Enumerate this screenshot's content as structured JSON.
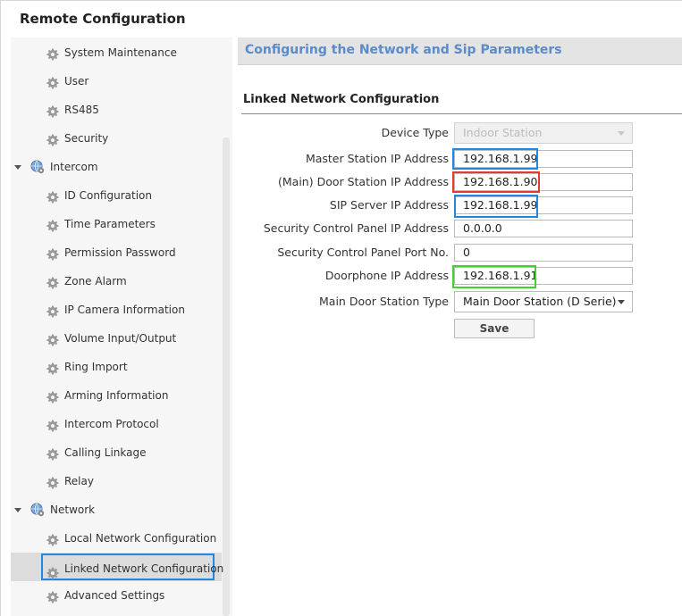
{
  "window": {
    "title": "Remote Configuration"
  },
  "colors": {
    "accent_blue": "#1e88e5",
    "highlight_red": "#e53935",
    "highlight_green": "#43d12f",
    "header_text": "#5b8bc9"
  },
  "sidebar": {
    "items": [
      {
        "label": "System Maintenance",
        "icon": "gear-icon"
      },
      {
        "label": "User",
        "icon": "gear-icon"
      },
      {
        "label": "RS485",
        "icon": "gear-icon"
      },
      {
        "label": "Security",
        "icon": "gear-icon"
      },
      {
        "label": "Intercom",
        "icon": "globe-icon",
        "group": true
      },
      {
        "label": "ID Configuration",
        "icon": "gear-icon"
      },
      {
        "label": "Time Parameters",
        "icon": "gear-icon"
      },
      {
        "label": "Permission Password",
        "icon": "gear-icon"
      },
      {
        "label": "Zone Alarm",
        "icon": "gear-icon"
      },
      {
        "label": "IP Camera Information",
        "icon": "gear-icon"
      },
      {
        "label": "Volume Input/Output",
        "icon": "gear-icon"
      },
      {
        "label": "Ring Import",
        "icon": "gear-icon"
      },
      {
        "label": "Arming Information",
        "icon": "gear-icon"
      },
      {
        "label": "Intercom Protocol",
        "icon": "gear-icon"
      },
      {
        "label": "Calling Linkage",
        "icon": "gear-icon"
      },
      {
        "label": "Relay",
        "icon": "gear-icon"
      },
      {
        "label": "Network",
        "icon": "globe-icon",
        "group": true
      },
      {
        "label": "Local Network Configuration",
        "icon": "gear-icon"
      },
      {
        "label": "Linked Network Configuration",
        "icon": "gear-icon",
        "selected": true
      },
      {
        "label": "Advanced Settings",
        "icon": "gear-icon"
      }
    ]
  },
  "main": {
    "header": "Configuring the Network and Sip Parameters",
    "section": "Linked Network Configuration",
    "fields": {
      "device_type": {
        "label": "Device Type",
        "value": "Indoor Station"
      },
      "master_station_ip": {
        "label": "Master Station IP Address",
        "value": "192.168.1.99"
      },
      "main_door_station_ip": {
        "label": "(Main) Door Station IP Address",
        "value": "192.168.1.90"
      },
      "sip_server_ip": {
        "label": "SIP Server IP Address",
        "value": "192.168.1.99"
      },
      "security_panel_ip": {
        "label": "Security Control Panel IP Address",
        "value": "0.0.0.0"
      },
      "security_panel_port": {
        "label": "Security Control Panel Port No.",
        "value": "0"
      },
      "doorphone_ip": {
        "label": "Doorphone IP Address",
        "value": "192.168.1.91"
      },
      "main_door_station_type": {
        "label": "Main Door Station Type",
        "value": "Main Door Station (D Serie)"
      }
    },
    "save_label": "Save"
  }
}
